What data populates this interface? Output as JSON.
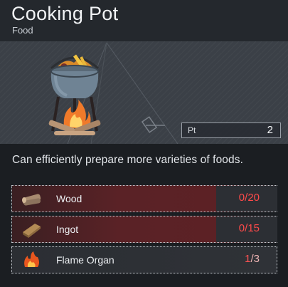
{
  "item": {
    "title": "Cooking Pot",
    "category": "Food",
    "description": "Can efficiently prepare more varieties of foods."
  },
  "points": {
    "label": "Pt",
    "value": "2"
  },
  "materials": [
    {
      "name": "Wood",
      "have": "0",
      "need": "20",
      "icon": "wood-icon",
      "status": "missing"
    },
    {
      "name": "Ingot",
      "have": "0",
      "need": "15",
      "icon": "ingot-icon",
      "status": "missing"
    },
    {
      "name": "Flame Organ",
      "have": "1",
      "need": "3",
      "icon": "flame-organ-icon",
      "status": "partial"
    }
  ],
  "colors": {
    "missing": "#ff4a4a",
    "panel": "#1b1e22",
    "preview": "#3b4047"
  }
}
